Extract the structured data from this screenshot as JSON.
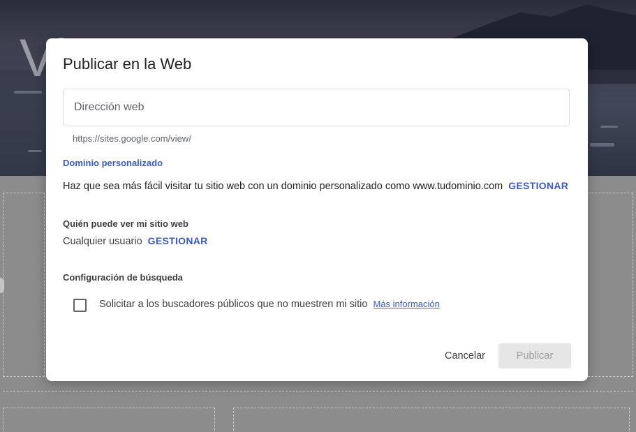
{
  "background": {
    "site_title_fragment": "Vi   S   t  "
  },
  "dialog": {
    "title": "Publicar en la Web",
    "web_address": {
      "placeholder": "Dirección web",
      "value": "",
      "helper": "https://sites.google.com/view/"
    },
    "custom_domain": {
      "link_label": "Dominio personalizado",
      "description": "Haz que sea más fácil visitar tu sitio web con un dominio personalizado como www.tudominio.com",
      "manage_label": "GESTIONAR"
    },
    "visibility": {
      "heading": "Quién puede ver mi sitio web",
      "value": "Cualquier usuario",
      "manage_label": "GESTIONAR"
    },
    "search": {
      "heading": "Configuración de búsqueda",
      "checkbox_label": "Solicitar a los buscadores públicos que no muestren mi sitio",
      "checked": false,
      "more_info_label": "Más información"
    },
    "actions": {
      "cancel_label": "Cancelar",
      "publish_label": "Publicar",
      "publish_enabled": false
    }
  },
  "colors": {
    "accent": "#3c5bbf",
    "overlay": "#8c8c8c",
    "disabled_button_bg": "#e6e6e6"
  }
}
